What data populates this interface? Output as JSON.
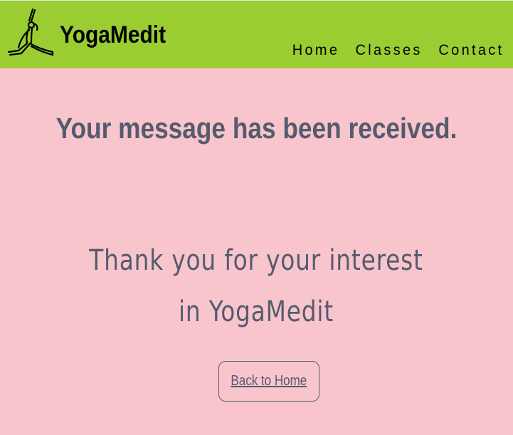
{
  "header": {
    "brand": "YogaMedit",
    "logo_icon": "yoga-pose-icon",
    "background_color": "#9acd32",
    "nav": [
      {
        "label": "Home"
      },
      {
        "label": "Classes"
      },
      {
        "label": "Contact"
      }
    ]
  },
  "main": {
    "headline": "Your message has been received.",
    "thanks": "Thank you for your interest in YogaMedit",
    "back_button": "Back to Home",
    "background_color": "#f8c5cc",
    "text_color": "#555b6e"
  }
}
